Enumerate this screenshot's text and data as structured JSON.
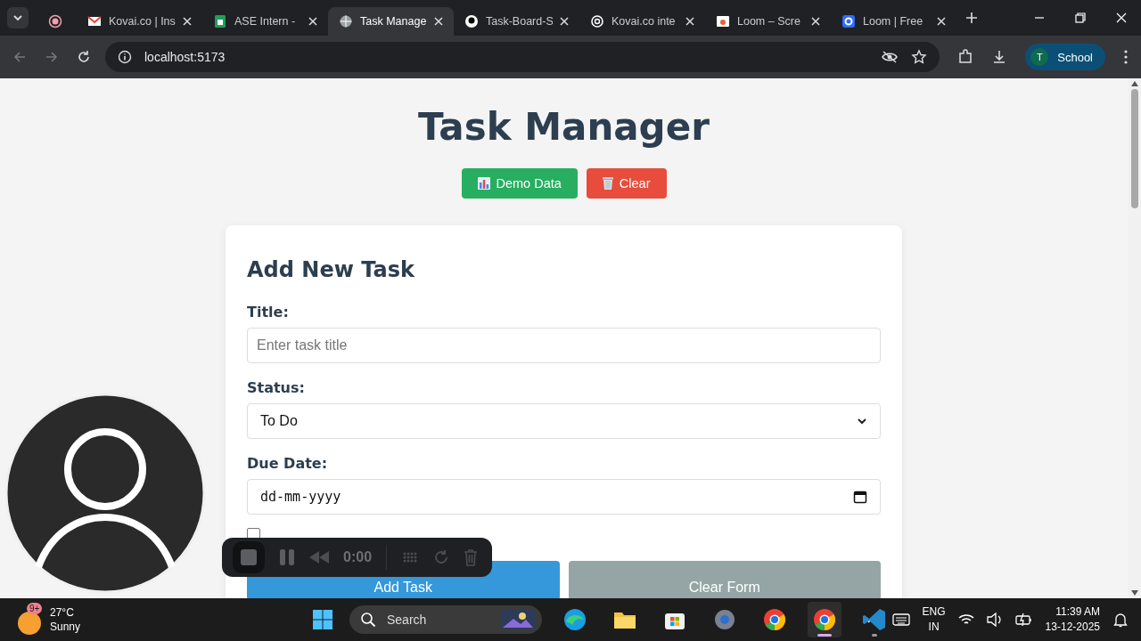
{
  "browser": {
    "tabs": [
      {
        "selected": false
      },
      {
        "title": "Kovai.co | Ins",
        "selected": false
      },
      {
        "title": "ASE Intern -",
        "selected": false
      },
      {
        "title": "Task Manage",
        "selected": true
      },
      {
        "title": "Task-Board-S",
        "selected": false
      },
      {
        "title": "Kovai.co inte",
        "selected": false
      },
      {
        "title": "Loom – Scre",
        "selected": false
      },
      {
        "title": "Loom | Free",
        "selected": false
      }
    ],
    "address": "localhost:5173",
    "profile_initial": "T",
    "profile": "School"
  },
  "page": {
    "title": "Task Manager",
    "actions": [
      {
        "kind": "demo",
        "label": "Demo Data"
      },
      {
        "kind": "clear",
        "label": "Clear"
      }
    ],
    "form": {
      "heading": "Add New Task",
      "fields": [
        {
          "kind": "text",
          "label": "Title:",
          "placeholder": "Enter task title"
        },
        {
          "kind": "select",
          "label": "Status:",
          "value": "To Do"
        },
        {
          "kind": "date",
          "label": "Due Date:",
          "placeholder": "dd-mm-yyyy"
        }
      ],
      "reminder": {
        "checked": false
      },
      "buttons": [
        {
          "kind": "primary",
          "label": "Add Task"
        },
        {
          "kind": "secondary",
          "label": "Clear Form"
        }
      ]
    }
  },
  "recorder": {
    "time": "0:00"
  },
  "taskbar": {
    "weather": {
      "badge": "9+",
      "temp": "27°C",
      "condition": "Sunny"
    },
    "search": {
      "placeholder": "Search"
    },
    "apps": [
      {
        "kind": "edge",
        "running": false,
        "active": false
      },
      {
        "kind": "folder",
        "running": false,
        "active": false
      },
      {
        "kind": "store",
        "running": false,
        "active": false
      },
      {
        "kind": "settings",
        "running": false,
        "active": false
      },
      {
        "kind": "chrome",
        "running": false,
        "active": false
      },
      {
        "kind": "chrome",
        "running": true,
        "active": true
      },
      {
        "kind": "code",
        "running": true,
        "active": false
      }
    ],
    "language": "ENG",
    "region": "IN",
    "time": "11:39 AM",
    "date": "13-12-2025"
  }
}
